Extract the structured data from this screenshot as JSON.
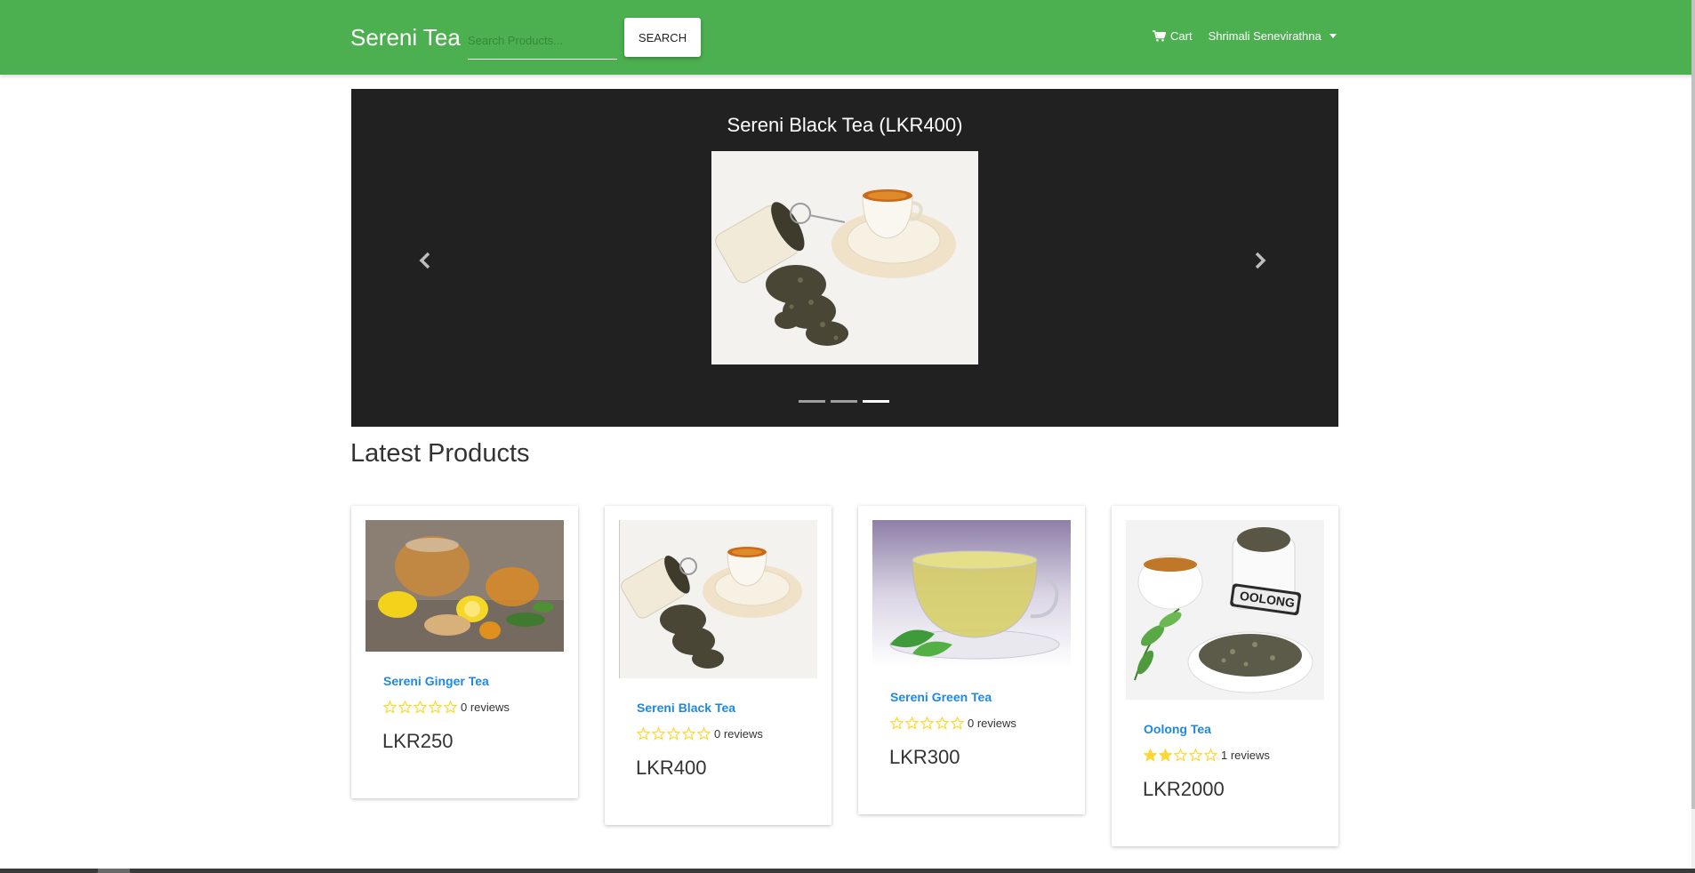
{
  "navbar": {
    "brand": "Sereni Tea",
    "search_placeholder": "Search Products...",
    "search_button": "SEARCH",
    "cart_label": "Cart",
    "user_name": "Shrimali Senevirathna"
  },
  "carousel": {
    "title": "Sereni Black Tea (LKR400)",
    "indicators": 3,
    "active_indicator": 3
  },
  "latest": {
    "title": "Latest Products",
    "products": [
      {
        "name": "Sereni Ginger Tea",
        "rating": 0,
        "reviews": "0 reviews",
        "price": "LKR250"
      },
      {
        "name": "Sereni Black Tea",
        "rating": 0,
        "reviews": "0 reviews",
        "price": "LKR400"
      },
      {
        "name": "Sereni Green Tea",
        "rating": 0,
        "reviews": "0 reviews",
        "price": "LKR300"
      },
      {
        "name": "Oolong Tea",
        "rating": 2,
        "reviews": "1 reviews",
        "price": "LKR2000"
      }
    ]
  },
  "colors": {
    "brand_green": "#4caf50",
    "carousel_bg": "#212121",
    "link_blue": "#1e88e5",
    "star_yellow": "#fdd835"
  },
  "icons": {
    "cart": "cart-icon",
    "prev": "chevron-left-icon",
    "next": "chevron-right-icon",
    "star": "star-icon"
  }
}
